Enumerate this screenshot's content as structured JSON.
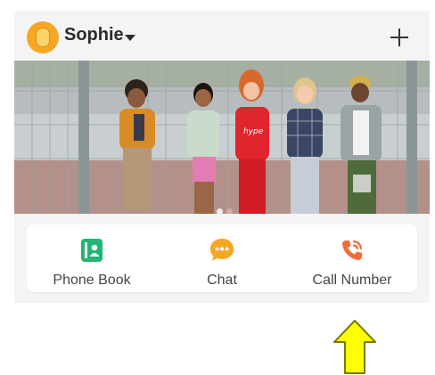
{
  "header": {
    "user_name": "Sophie",
    "avatar_icon": "watch-avatar-icon",
    "add_icon": "plus-icon"
  },
  "banner": {
    "image": "kids-photo",
    "slides": 2,
    "active_slide": 1
  },
  "actions": [
    {
      "label": "Phone Book",
      "icon": "contact-book-icon",
      "color": "#22b573"
    },
    {
      "label": "Chat",
      "icon": "chat-bubble-icon",
      "color": "#f5a623"
    },
    {
      "label": "Call Number",
      "icon": "phone-call-icon",
      "color": "#f26b3a"
    }
  ],
  "colors": {
    "accent_green": "#22b573",
    "accent_orange": "#f5a623",
    "accent_red": "#f26b3a",
    "arrow_fill": "#ffff00"
  }
}
